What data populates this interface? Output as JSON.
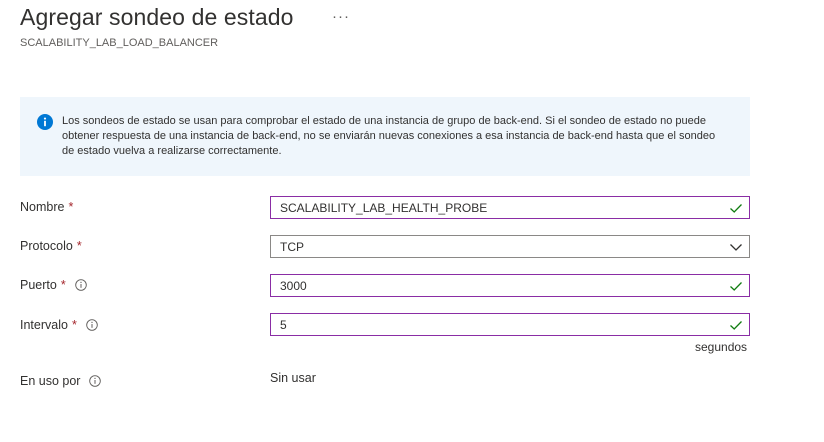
{
  "header": {
    "title": "Agregar sondeo de estado",
    "more_label": "···",
    "subtitle": "SCALABILITY_LAB_LOAD_BALANCER"
  },
  "info": {
    "text": "Los sondeos de estado se usan para comprobar el estado de una instancia de grupo de back-end. Si el sondeo de estado no puede obtener respuesta de una instancia de back-end, no se enviarán nuevas conexiones a esa instancia de back-end hasta que el sondeo de estado vuelva a realizarse correctamente."
  },
  "form": {
    "name": {
      "label": "Nombre",
      "required": "*",
      "value": "SCALABILITY_LAB_HEALTH_PROBE"
    },
    "protocol": {
      "label": "Protocolo",
      "required": "*",
      "value": "TCP"
    },
    "port": {
      "label": "Puerto",
      "required": "*",
      "value": "3000"
    },
    "interval": {
      "label": "Intervalo",
      "required": "*",
      "value": "5",
      "units": "segundos"
    },
    "used_by": {
      "label": "En uso por",
      "value": "Sin usar"
    }
  },
  "colors": {
    "accent": "#8a2da5",
    "info_background": "#eff6fc",
    "info_icon": "#0078d4",
    "valid_check": "#107c10",
    "required": "#a4262c"
  }
}
